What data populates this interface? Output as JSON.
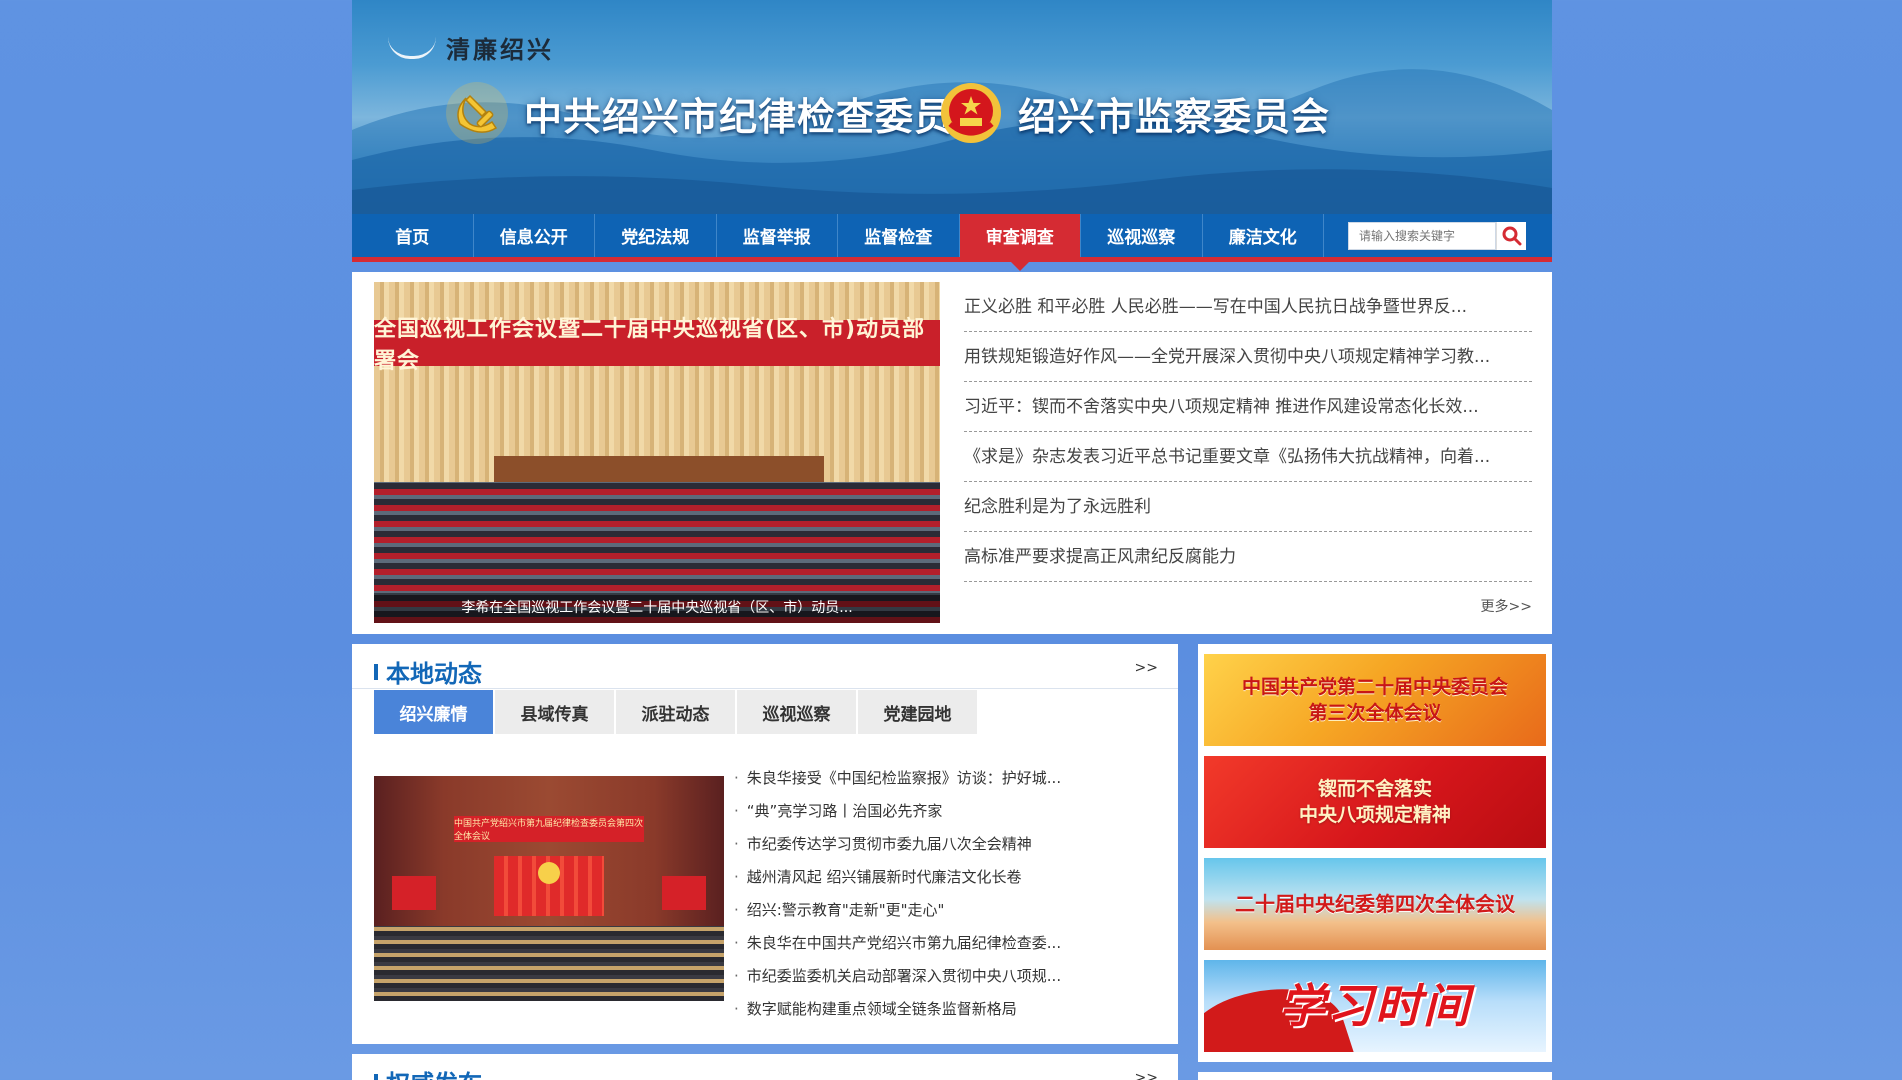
{
  "header": {
    "brand_small": "清廉绍兴",
    "org_left": "中共绍兴市纪律检查委员会",
    "org_right": "绍兴市监察委员会"
  },
  "nav": {
    "items": [
      "首页",
      "信息公开",
      "党纪法规",
      "监督举报",
      "监督检查",
      "审查调查",
      "巡视巡察",
      "廉洁文化"
    ],
    "active": "审查调查",
    "search_placeholder": "请输入搜索关键字"
  },
  "focus": {
    "slide_banner": "全国巡视工作会议暨二十届中央巡视省(区、市)动员部署会",
    "slide_caption": "李希在全国巡视工作会议暨二十届中央巡视省（区、市）动员...",
    "news": [
      "正义必胜 和平必胜 人民必胜——写在中国人民抗日战争暨世界反...",
      "用铁规矩锻造好作风——全党开展深入贯彻中央八项规定精神学习教...",
      "习近平：锲而不舍落实中央八项规定精神 推进作风建设常态化长效...",
      "《求是》杂志发表习近平总书记重要文章《弘扬伟大抗战精神，向着...",
      "纪念胜利是为了永远胜利",
      "高标准严要求提高正风肃纪反腐能力"
    ],
    "more": "更多>>"
  },
  "local": {
    "title": "本地动态",
    "more": ">>",
    "tabs": [
      "绍兴廉情",
      "县域传真",
      "派驻动态",
      "巡视巡察",
      "党建园地"
    ],
    "active_tab": "绍兴廉情",
    "image_board": "中国共产党绍兴市第九届纪律检查委员会第四次全体会议",
    "news": [
      "朱良华接受《中国纪检监察报》访谈：护好城...",
      "“典”亮学习路丨治国必先齐家",
      "市纪委传达学习贯彻市委九届八次全会精神",
      "越州清风起 绍兴铺展新时代廉洁文化长卷",
      "绍兴:警示教育\"走新\"更\"走心\"",
      "朱良华在中国共产党绍兴市第九届纪律检查委...",
      "市纪委监委机关启动部署深入贯彻中央八项规...",
      "数字赋能构建重点领域全链条监督新格局"
    ]
  },
  "authority": {
    "title": "权威发布",
    "more": ">>"
  },
  "banners": [
    {
      "l1": "中国共产党第二十届中央委员会",
      "l2": "第三次全体会议"
    },
    {
      "l1": "锲而不舍落实",
      "l2": "中央八项规定精神"
    },
    {
      "l1": "二十届中央纪委第四次全体会议",
      "l2": ""
    },
    {
      "l1": "学习时间",
      "l2": ""
    }
  ],
  "colors": {
    "nav_blue": "#0e63b4",
    "active_red": "#d52b33",
    "title_blue": "#1267b7",
    "tab_active": "#4a84d9",
    "page_bg": "#5f93e2"
  }
}
